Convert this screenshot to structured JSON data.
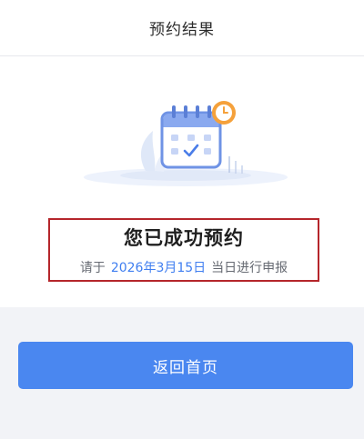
{
  "header": {
    "title": "预约结果"
  },
  "result": {
    "title": "您已成功预约",
    "prefix": "请于",
    "date": "2026年3月15日",
    "suffix": "当日进行申报"
  },
  "actions": {
    "home_label": "返回首页"
  },
  "colors": {
    "accent": "#4a87f0",
    "date_text": "#3f7ef0",
    "highlight_border": "#b5262b",
    "clock_badge": "#f5a13b"
  },
  "icons": {
    "illustration": "calendar-check-icon",
    "badge": "clock-icon"
  }
}
